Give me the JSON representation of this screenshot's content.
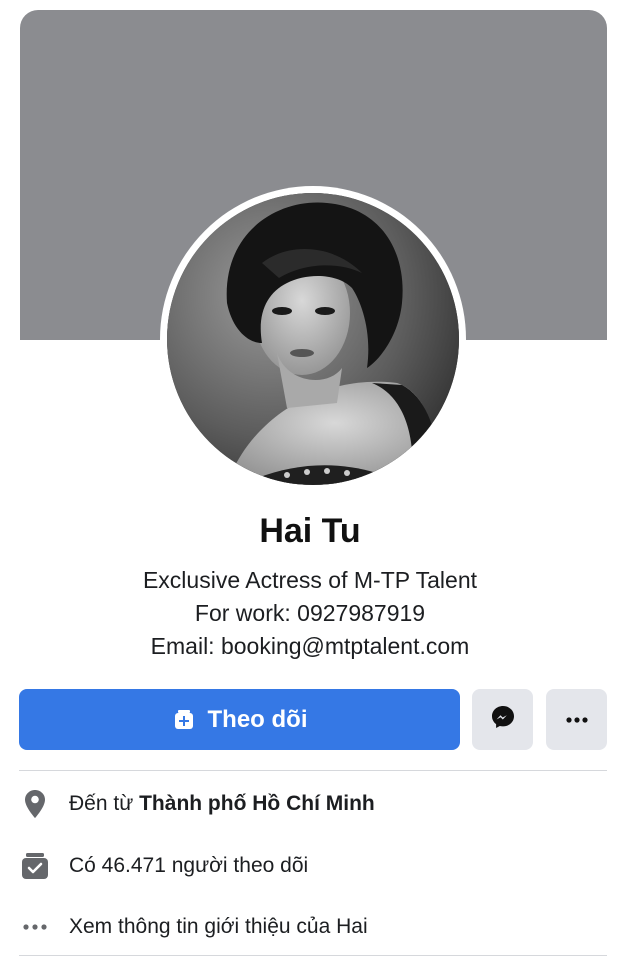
{
  "profile": {
    "name": "Hai Tu",
    "bio": [
      "Exclusive Actress of M-TP Talent",
      "For work: 0927987919",
      "Email: booking@mtptalent.com"
    ]
  },
  "actions": {
    "follow_label": "Theo dõi",
    "messenger_icon": "messenger-icon",
    "more_icon": "more-dots-icon"
  },
  "intro": {
    "hometown_prefix": "Đến từ",
    "hometown_city": "Thành phố Hồ Chí Minh",
    "followers_text": "Có 46.471 người theo dõi",
    "see_about_text": "Xem thông tin giới thiệu của Hai"
  },
  "colors": {
    "cover": "#8b8c90",
    "primary": "#3578e5",
    "secondary_button": "#e4e6eb",
    "icon_gray": "#65676b"
  }
}
